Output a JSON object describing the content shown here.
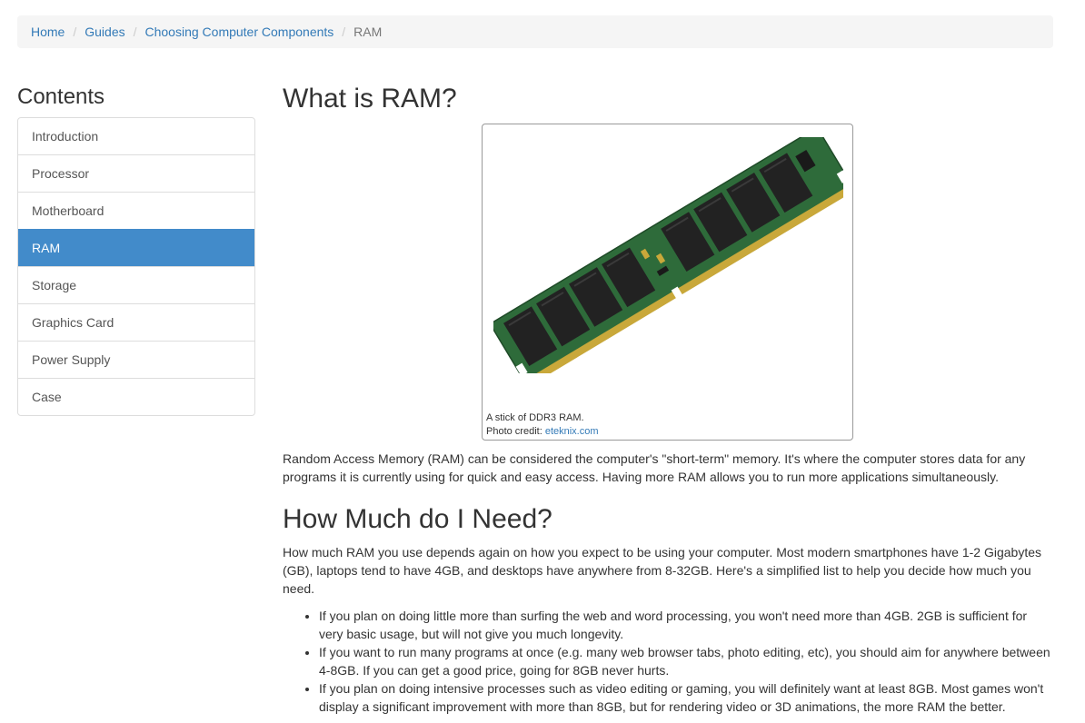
{
  "breadcrumb": {
    "items": [
      "Home",
      "Guides",
      "Choosing Computer Components"
    ],
    "current": "RAM",
    "separator": "/"
  },
  "sidebar": {
    "title": "Contents",
    "items": [
      {
        "label": "Introduction"
      },
      {
        "label": "Processor"
      },
      {
        "label": "Motherboard"
      },
      {
        "label": "RAM",
        "active": true
      },
      {
        "label": "Storage"
      },
      {
        "label": "Graphics Card"
      },
      {
        "label": "Power Supply"
      },
      {
        "label": "Case"
      }
    ]
  },
  "main": {
    "title": "What is RAM?",
    "figure": {
      "caption": "A stick of DDR3 RAM.",
      "credit_prefix": "Photo credit:",
      "credit_link": "eteknix.com"
    },
    "intro": "Random Access Memory (RAM) can be considered the computer's \"short-term\" memory. It's where the computer stores data for any programs it is currently using for quick and easy access. Having more RAM allows you to run more applications simultaneously.",
    "section_title": "How Much do I Need?",
    "section_text": "How much RAM you use depends again on how you expect to be using your computer. Most modern smartphones have 1-2 Gigabytes (GB), laptops tend to have 4GB, and desktops have anywhere from 8-32GB. Here's a simplified list to help you decide how much you need.",
    "bullets": [
      "If you plan on doing little more than surfing the web and word processing, you won't need more than 4GB. 2GB is sufficient for very basic usage, but will not give you much longevity.",
      "If you want to run many programs at once (e.g. many web browser tabs, photo editing, etc), you should aim for anywhere between 4-8GB. If you can get a good price, going for 8GB never hurts.",
      "If you plan on doing intensive processes such as video editing or gaming, you will definitely want at least 8GB. Most games won't display a significant improvement with more than 8GB, but for rendering video or 3D animations, the more RAM the better."
    ]
  },
  "colors": {
    "link": "#337ab7",
    "active_item_bg": "#428bca",
    "pcb_green": "#2e6b3a",
    "chip_black": "#222222",
    "gold_pins": "#c9a83a"
  }
}
